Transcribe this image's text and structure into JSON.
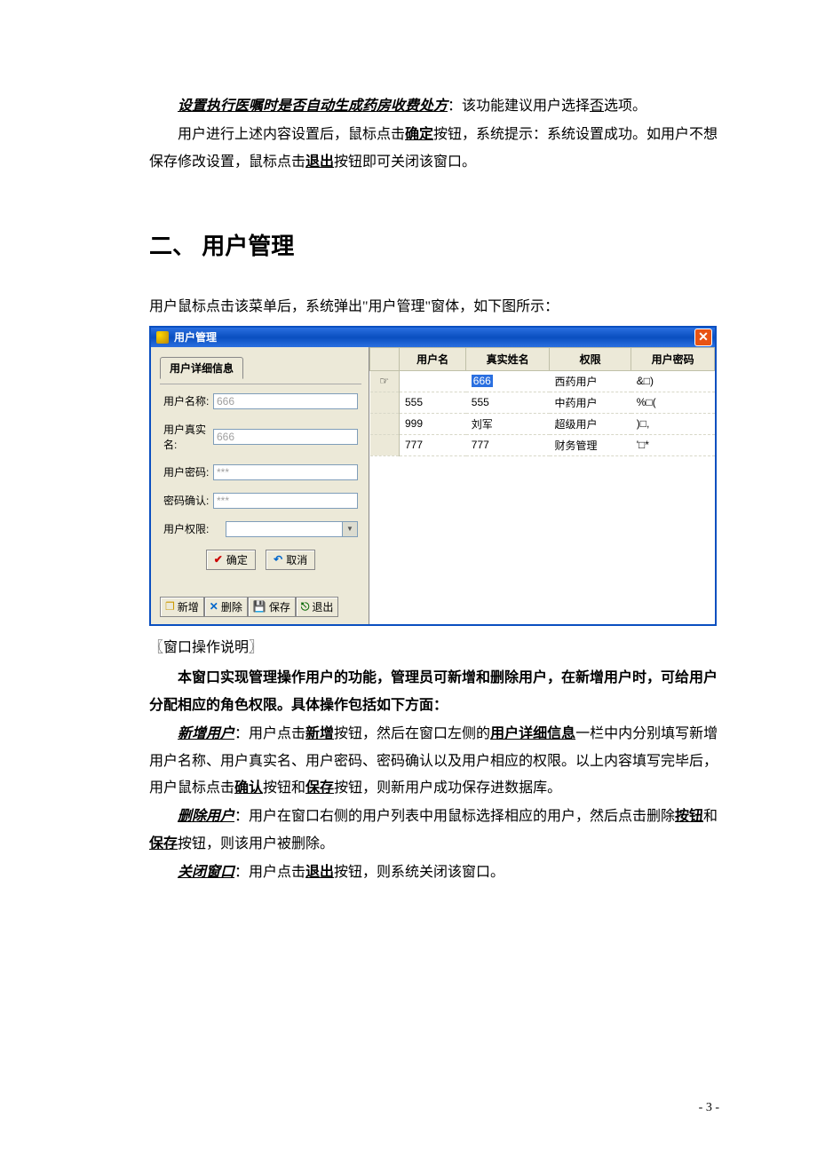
{
  "intro": {
    "l1a": "设置执行医嘱时是否自动生成药房收费处方",
    "l1b": "：该功能建议用户选择",
    "l1c": "否",
    "l1d": "选项。",
    "l2a": "用户进行上述内容设置后，鼠标点击",
    "l2b": "确定",
    "l2c": "按钮，系统提示：系统设置成功。如用户不想保存修改设置，鼠标点击",
    "l2d": "退出",
    "l2e": "按钮即可关闭该窗口。"
  },
  "heading": "二、 用户管理",
  "lead": "用户鼠标点击该菜单后，系统弹出\"用户管理\"窗体，如下图所示：",
  "win": {
    "title": "用户管理",
    "tab": "用户详细信息",
    "labels": {
      "username": "用户名称:",
      "realname": "用户真实名:",
      "password": "用户密码:",
      "confirm": "密码确认:",
      "role": "用户权限:"
    },
    "values": {
      "username": "666",
      "realname": "666",
      "password": "***",
      "confirm": "***"
    },
    "buttons": {
      "ok": "确定",
      "cancel": "取消"
    },
    "toolbar": {
      "add": "新增",
      "del": "删除",
      "save": "保存",
      "exit": "退出"
    },
    "table": {
      "headers": {
        "user": "用户名",
        "real": "真实姓名",
        "role": "权限",
        "pwd": "用户密码"
      },
      "rows": [
        {
          "ind": "☞",
          "user": "",
          "real": "666",
          "role": "西药用户",
          "pwd": "&□)",
          "sel": true
        },
        {
          "ind": "",
          "user": "555",
          "real": "555",
          "role": "中药用户",
          "pwd": "%□("
        },
        {
          "ind": "",
          "user": "999",
          "real": "刘军",
          "role": "超级用户",
          "pwd": ")□,"
        },
        {
          "ind": "",
          "user": "777",
          "real": "777",
          "role": "财务管理",
          "pwd": "'□*"
        }
      ]
    }
  },
  "ops": {
    "title_l": "〖",
    "title": "窗口操作说明",
    "title_r": "〗",
    "p1": "本窗口实现管理操作用户的功能，管理员可新增和删除用户，在新增用户时，可给用户分配相应的角色权限。具体操作包括如下方面：",
    "add_t": "新增用户",
    "add_a": "：用户点击",
    "add_b": "新增",
    "add_c": "按钮，然后在窗口左侧的",
    "add_d": "用户详细信息",
    "add_e": "一栏中内分别填写新增用户名称、用户真实名、用户密码、密码确认以及用户相应的权限。以上内容填写完毕后，用户鼠标点击",
    "add_f": "确认",
    "add_g": "按钮和",
    "add_h": "保存",
    "add_i": "按钮，则新用户成功保存进数据库。",
    "del_t": "删除用户",
    "del_a": "：用户在窗口右侧的用户列表中用鼠标选择相应的用户，然后点击删除",
    "del_b": "按钮",
    "del_c": "和",
    "del_d": "保存",
    "del_e": "按钮，则该用户被删除。",
    "close_t": "关闭窗口",
    "close_a": "：用户点击",
    "close_b": "退出",
    "close_c": "按钮，则系统关闭该窗口。"
  },
  "page_num": "- 3 -"
}
